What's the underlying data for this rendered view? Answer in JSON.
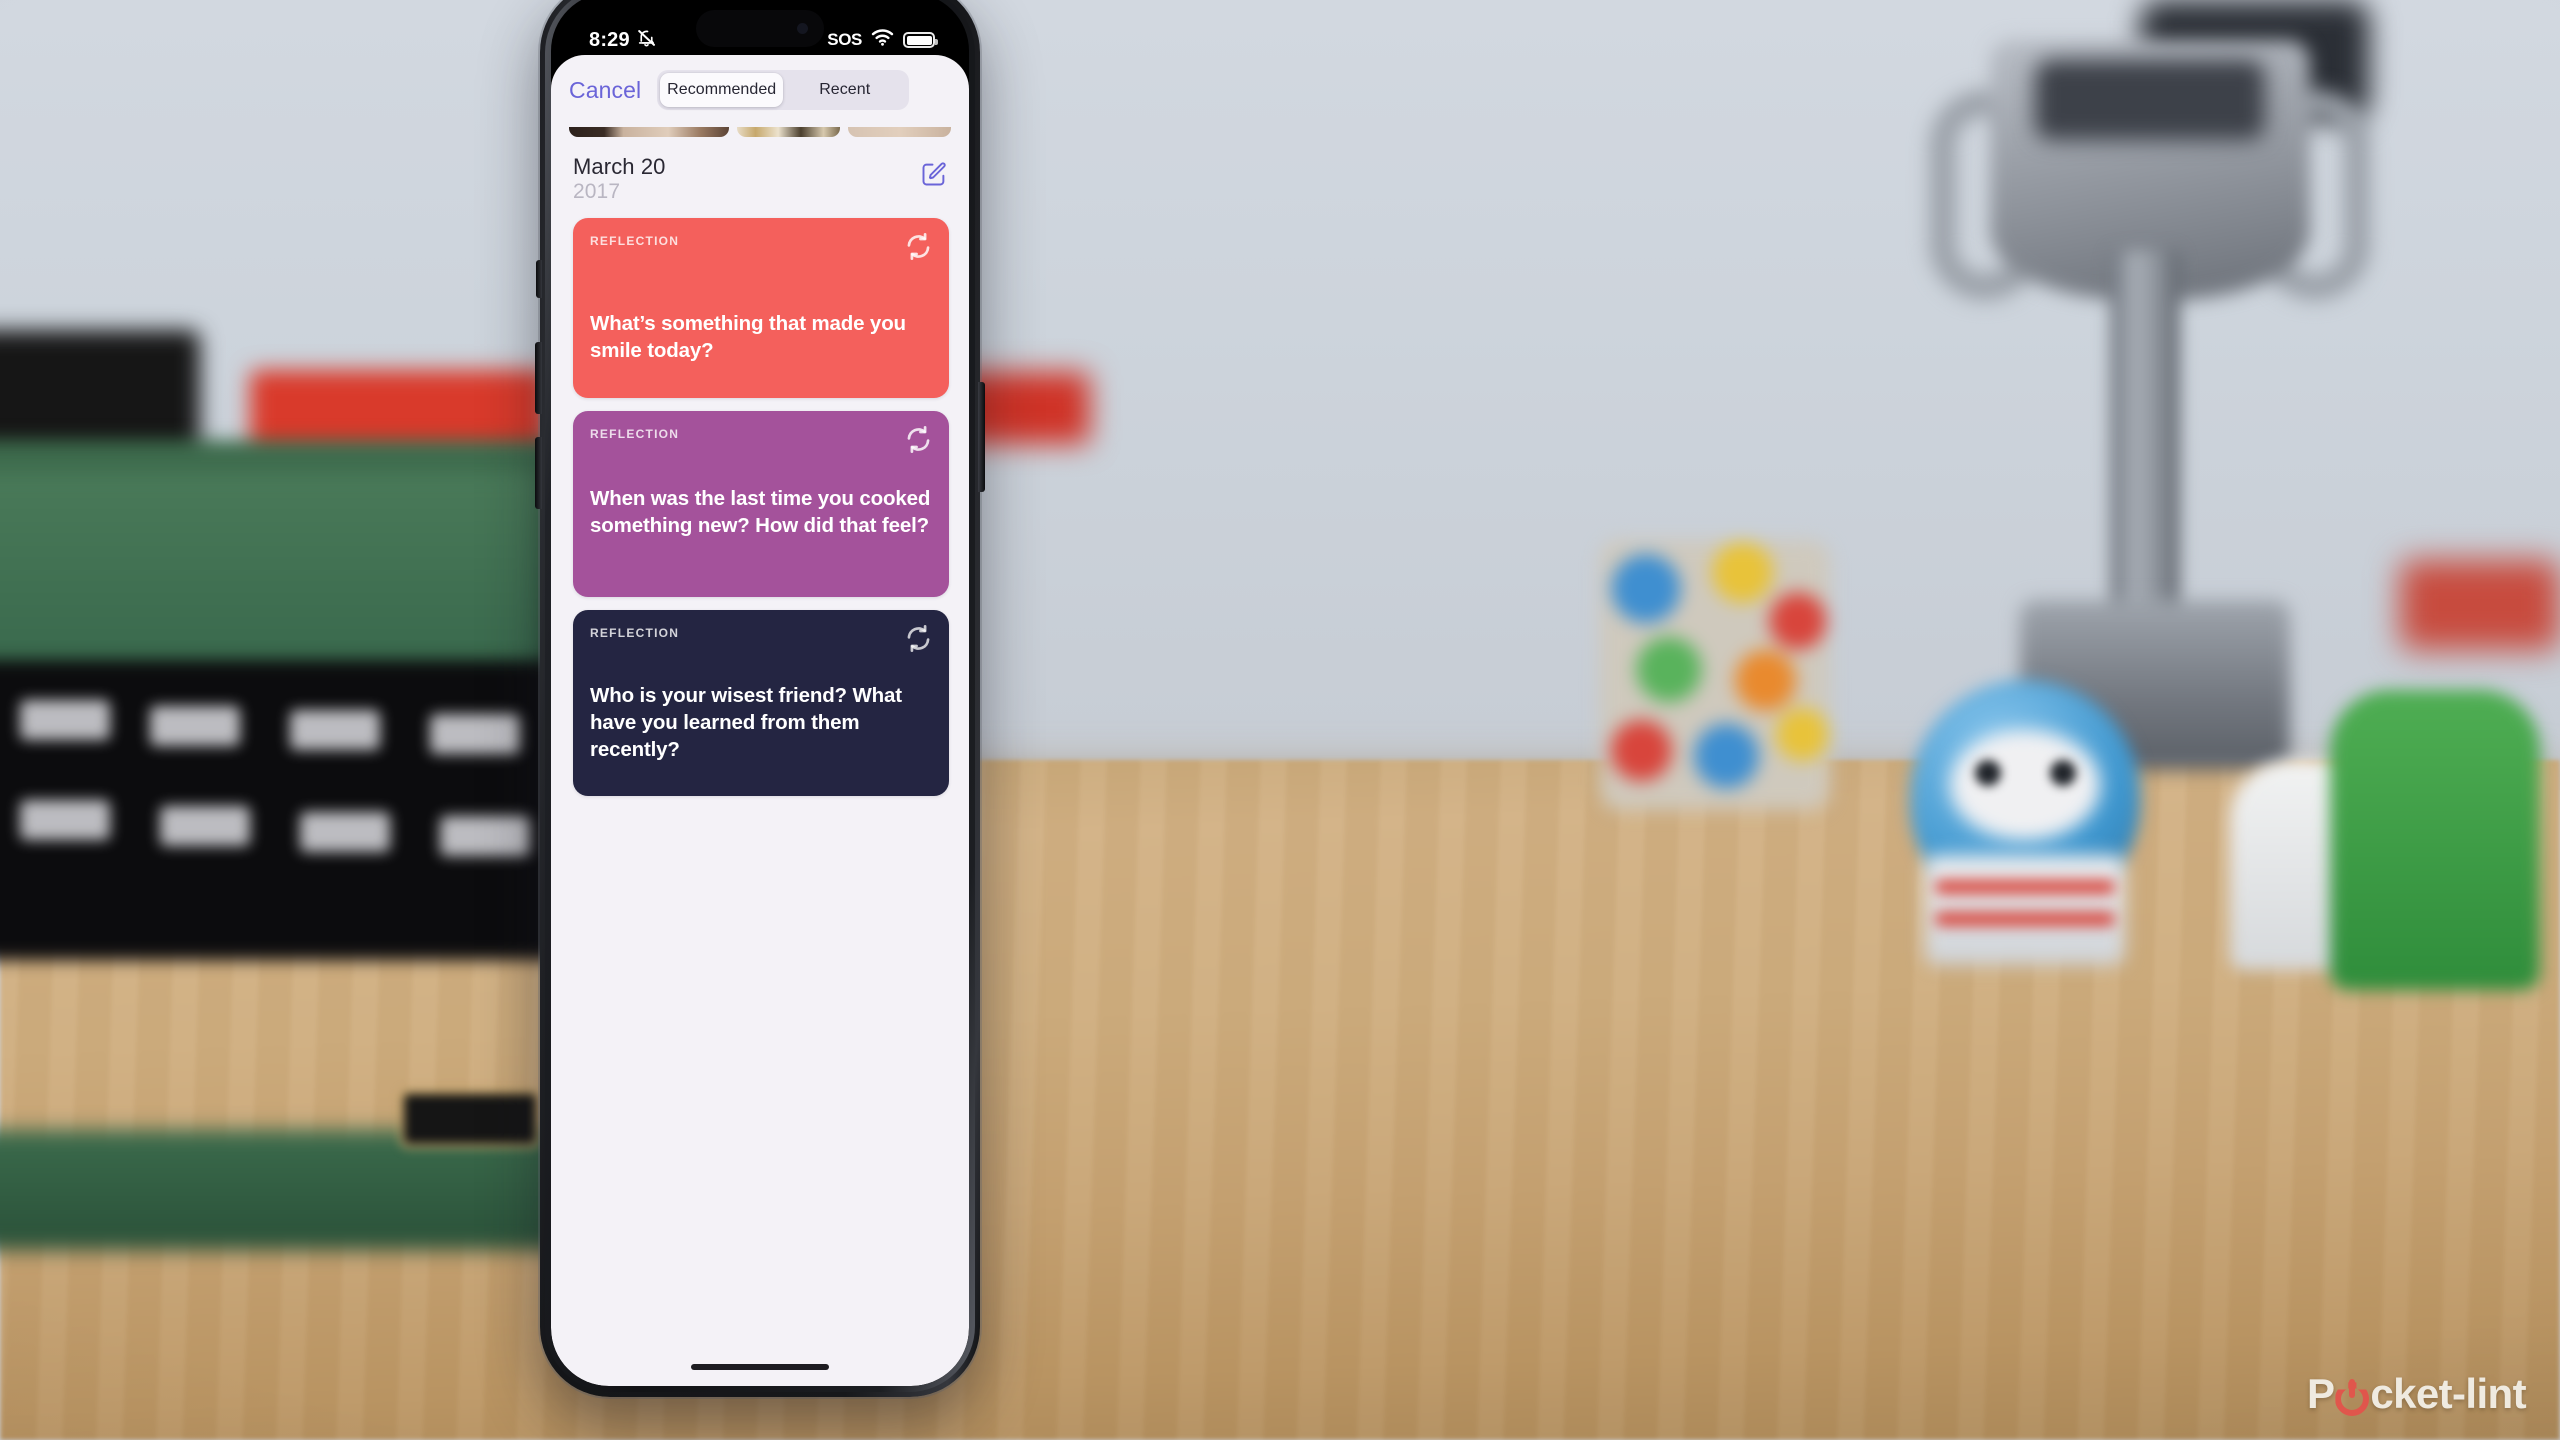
{
  "scene": {
    "description": "iPhone held in front of a blurred desk with a green Lego typewriter and a trophy"
  },
  "phone": {
    "status_bar": {
      "time": "8:29",
      "silent_icon": "bell-slash-icon",
      "sos_label": "SOS",
      "wifi_icon": "wifi-icon",
      "battery_icon": "battery-icon"
    },
    "nav": {
      "cancel_label": "Cancel",
      "segments": [
        {
          "label": "Recommended",
          "selected": true
        },
        {
          "label": "Recent",
          "selected": false
        }
      ]
    },
    "date_header": {
      "date": "March 20",
      "year": "2017",
      "compose_icon": "compose-icon"
    },
    "cards": [
      {
        "kicker": "REFLECTION",
        "question": "What’s something that made you smile today?",
        "color": "#f4605c",
        "refresh_icon": "refresh-icon"
      },
      {
        "kicker": "REFLECTION",
        "question": "When was the last time you cooked something new? How did that feel?",
        "color": "#a4529b",
        "refresh_icon": "refresh-icon"
      },
      {
        "kicker": "REFLECTION",
        "question": "Who is your wisest friend? What have you learned from them recently?",
        "color": "#242542",
        "refresh_icon": "refresh-icon"
      }
    ],
    "home_indicator": "home-indicator"
  },
  "watermark": {
    "text_before": "P",
    "text_after": "cket-lint",
    "accent_color": "#e0564c"
  }
}
